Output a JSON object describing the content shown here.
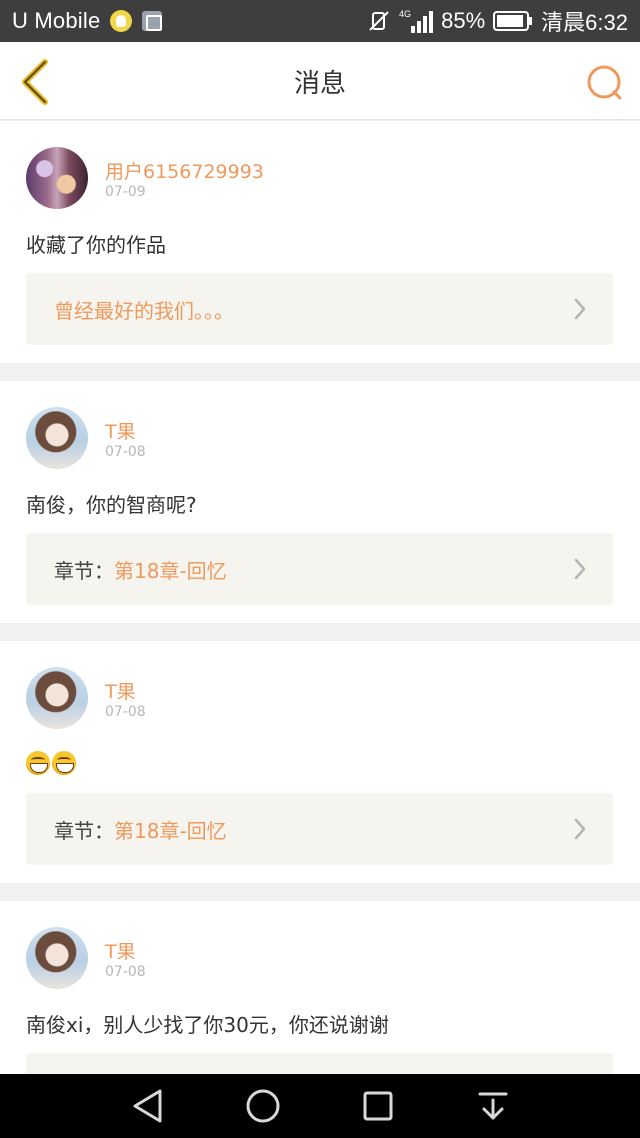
{
  "status_bar": {
    "carrier": "U Mobile",
    "network": "4G",
    "battery_percent": "85%",
    "time": "清晨6:32"
  },
  "header": {
    "title": "消息",
    "accent_color": "#ef9a5c"
  },
  "messages": [
    {
      "username": "用户6156729993",
      "date": "07-09",
      "text": "收藏了你的作品",
      "ref_label": "",
      "ref_value": "曾经最好的我们。。。"
    },
    {
      "username": "T果",
      "date": "07-08",
      "text": "南俊，你的智商呢?",
      "ref_label": "章节：",
      "ref_value": "第18章-回忆"
    },
    {
      "username": "T果",
      "date": "07-08",
      "text": "",
      "emoji": [
        "grin-emoji",
        "grin-emoji"
      ],
      "ref_label": "章节：",
      "ref_value": "第18章-回忆"
    },
    {
      "username": "T果",
      "date": "07-08",
      "text": "南俊xi，别人少找了你30元，你还说谢谢"
    }
  ]
}
